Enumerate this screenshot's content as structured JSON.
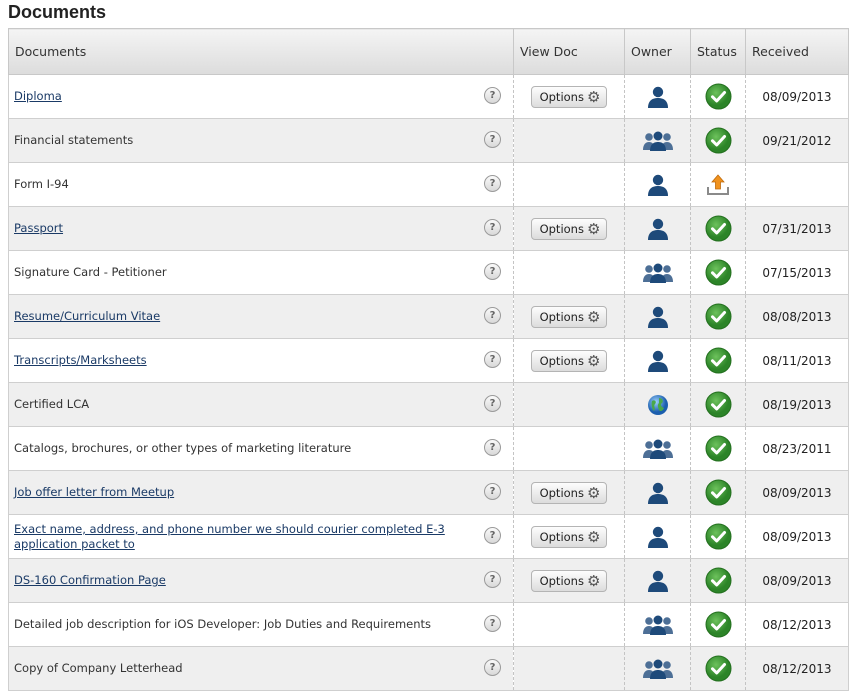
{
  "title": "Documents",
  "columns": [
    "Documents",
    "View Doc",
    "Owner",
    "Status",
    "Received"
  ],
  "options_label": "Options",
  "help_glyph": "?",
  "rows": [
    {
      "name": "Diploma",
      "link": true,
      "options": true,
      "owner": "person",
      "status": "check",
      "received": "08/09/2013"
    },
    {
      "name": "Financial statements",
      "link": false,
      "options": false,
      "owner": "group",
      "status": "check",
      "received": "09/21/2012"
    },
    {
      "name": "Form I-94",
      "link": false,
      "options": false,
      "owner": "person",
      "status": "upload",
      "received": ""
    },
    {
      "name": "Passport",
      "link": true,
      "options": true,
      "owner": "person",
      "status": "check",
      "received": "07/31/2013"
    },
    {
      "name": "Signature Card - Petitioner",
      "link": false,
      "options": false,
      "owner": "group",
      "status": "check",
      "received": "07/15/2013"
    },
    {
      "name": "Resume/Curriculum Vitae",
      "link": true,
      "options": true,
      "owner": "person",
      "status": "check",
      "received": "08/08/2013"
    },
    {
      "name": "Transcripts/Marksheets",
      "link": true,
      "options": true,
      "owner": "person",
      "status": "check",
      "received": "08/11/2013"
    },
    {
      "name": "Certified LCA",
      "link": false,
      "options": false,
      "owner": "globe",
      "status": "check",
      "received": "08/19/2013"
    },
    {
      "name": "Catalogs, brochures, or other types of marketing literature",
      "link": false,
      "options": false,
      "owner": "group",
      "status": "check",
      "received": "08/23/2011"
    },
    {
      "name": "Job offer letter from Meetup",
      "link": true,
      "options": true,
      "owner": "person",
      "status": "check",
      "received": "08/09/2013"
    },
    {
      "name": "Exact name, address, and phone number we should courier completed E-3 application packet to",
      "link": true,
      "options": true,
      "owner": "person",
      "status": "check",
      "received": "08/09/2013"
    },
    {
      "name": "DS-160 Confirmation Page",
      "link": true,
      "options": true,
      "owner": "person",
      "status": "check",
      "received": "08/09/2013"
    },
    {
      "name": "Detailed job description for iOS Developer: Job Duties and Requirements",
      "link": false,
      "options": false,
      "owner": "group",
      "status": "check",
      "received": "08/12/2013"
    },
    {
      "name": "Copy of Company Letterhead",
      "link": false,
      "options": false,
      "owner": "group",
      "status": "check",
      "received": "08/12/2013"
    }
  ],
  "icons": {
    "person": "person-icon",
    "group": "group-icon",
    "globe": "globe-icon",
    "check": "check-icon",
    "upload": "upload-icon",
    "gear": "gear-icon",
    "help": "help-icon"
  },
  "colors": {
    "owner_icon": "#1e4a7a",
    "check_green": "#3a9a33",
    "upload_orange": "#f0921e",
    "link": "#1a3a66"
  }
}
